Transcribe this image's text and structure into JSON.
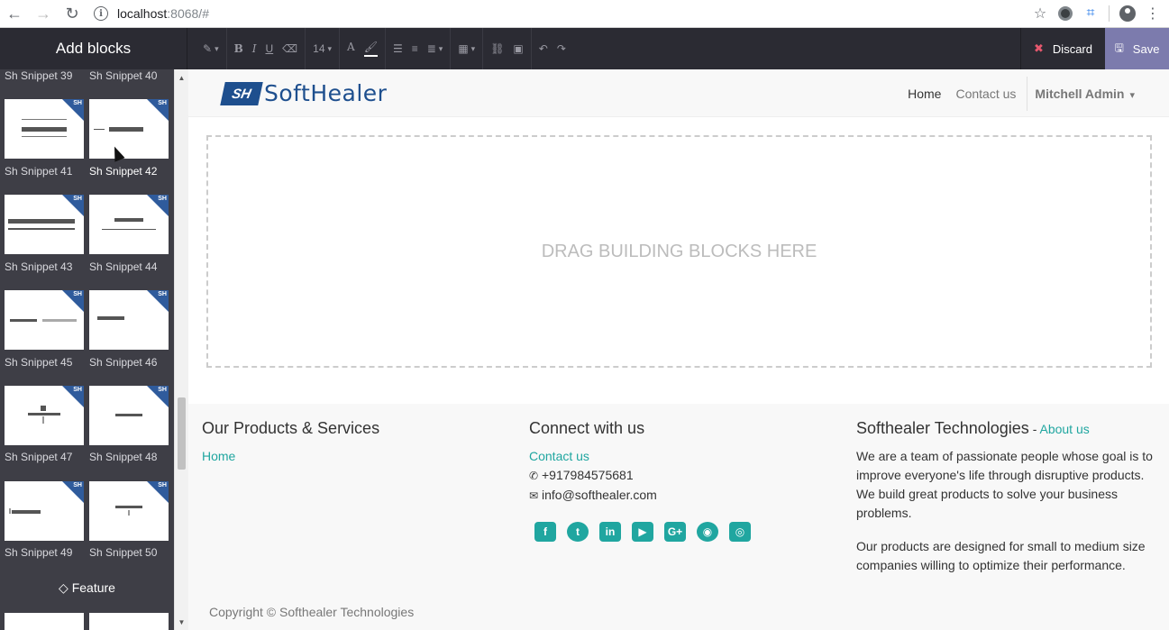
{
  "browser": {
    "url_host": "localhost",
    "url_rest": ":8068/#"
  },
  "toolbar": {
    "add_blocks": "Add blocks",
    "font_size": "14",
    "discard": "Discard",
    "save": "Save"
  },
  "sidebar": {
    "snippets": [
      "Sh Snippet 39",
      "Sh Snippet 40",
      "Sh Snippet 41",
      "Sh Snippet 42",
      "Sh Snippet 43",
      "Sh Snippet 44",
      "Sh Snippet 45",
      "Sh Snippet 46",
      "Sh Snippet 47",
      "Sh Snippet 48",
      "Sh Snippet 49",
      "Sh Snippet 50"
    ],
    "badge": "SH",
    "feature": "Feature"
  },
  "site": {
    "logo_mark": "SH",
    "logo_text": "SoftHealer",
    "menu": {
      "home": "Home",
      "contact": "Contact us",
      "user": "Mitchell Admin"
    },
    "dropzone": "DRAG BUILDING BLOCKS HERE",
    "footer": {
      "col1_title": "Our Products & Services",
      "col1_link": "Home",
      "col2_title": "Connect with us",
      "col2_link": "Contact us",
      "phone": "+917984575681",
      "email": "info@softhealer.com",
      "col3_title": "Softhealer Technologies",
      "col3_sep": " - ",
      "col3_about": "About us",
      "para1": "We are a team of passionate people whose goal is to improve everyone's life through disruptive products. We build great products to solve your business problems.",
      "para2": "Our products are designed for small to medium size companies willing to optimize their performance.",
      "copyright": "Copyright © Softhealer Technologies"
    }
  }
}
